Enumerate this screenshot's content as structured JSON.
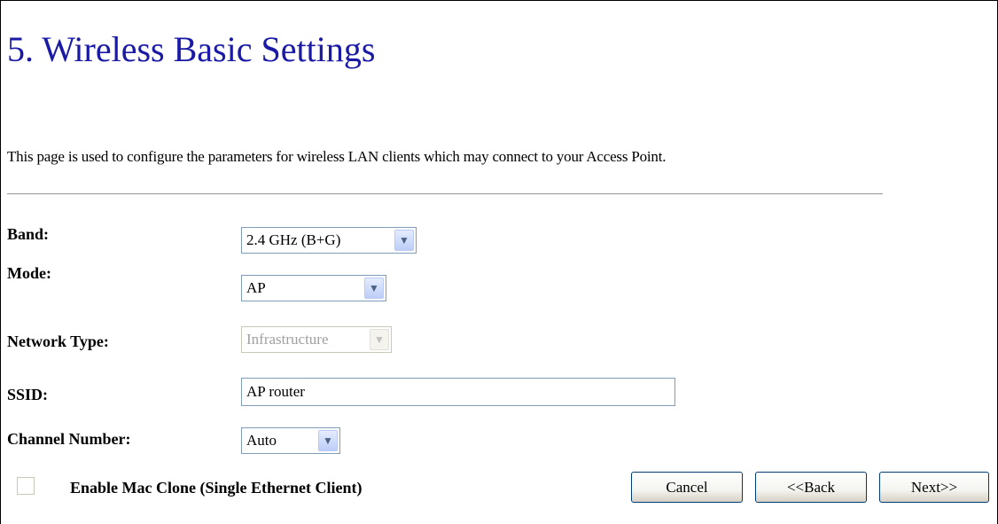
{
  "page": {
    "title": "5. Wireless Basic Settings",
    "description": "This page is used to configure the parameters for wireless LAN clients which may connect to your Access Point."
  },
  "form": {
    "band": {
      "label": "Band:",
      "value": "2.4 GHz (B+G)"
    },
    "mode": {
      "label": "Mode:",
      "value": "AP"
    },
    "network_type": {
      "label": "Network Type:",
      "value": "Infrastructure",
      "disabled": true
    },
    "ssid": {
      "label": "SSID:",
      "value": "AP router"
    },
    "channel": {
      "label": "Channel Number:",
      "value": "Auto"
    },
    "mac_clone": {
      "label": "Enable Mac Clone (Single Ethernet Client)",
      "checked": false
    }
  },
  "buttons": {
    "cancel": "Cancel",
    "back": "<<Back",
    "next": "Next>>"
  },
  "icons": {
    "dropdown_arrow": "chevron-down-icon"
  },
  "colors": {
    "title": "#1a1aa6",
    "field_border": "#7f9db9",
    "button_border": "#003c74"
  }
}
